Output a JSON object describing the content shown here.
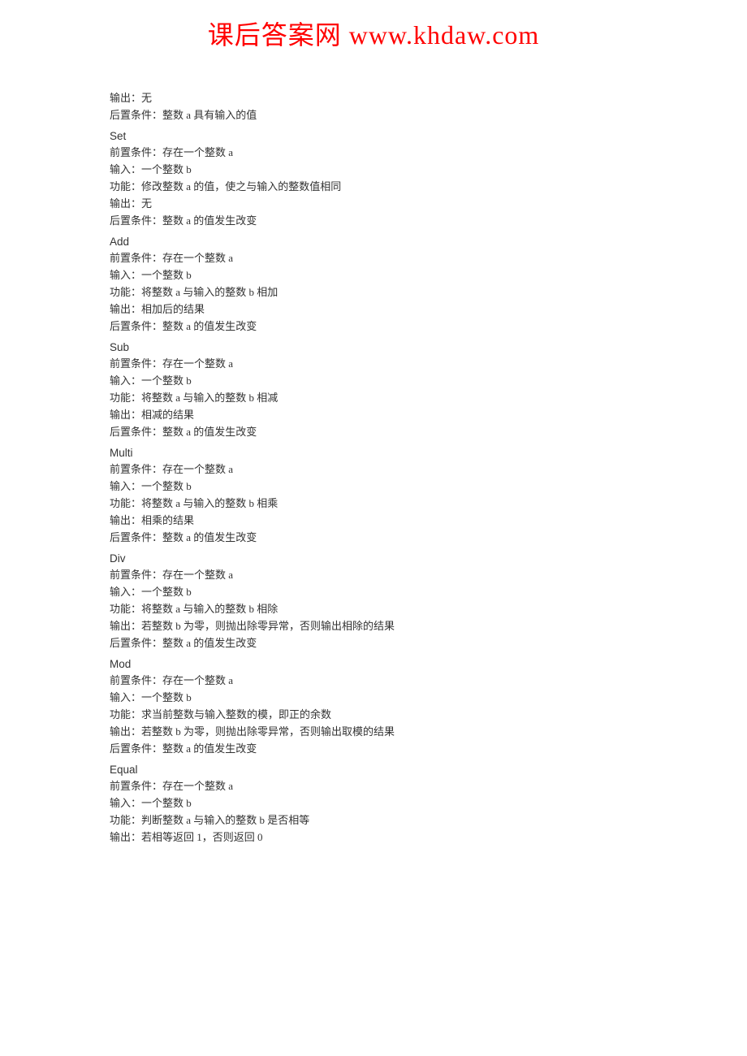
{
  "watermark": "课后答案网 www.khdaw.com",
  "intro": {
    "output": "输出：无",
    "post": "后置条件：整数 a 具有输入的值"
  },
  "sections": [
    {
      "title": "Set",
      "lines": [
        "前置条件：存在一个整数 a",
        "输入：一个整数 b",
        "功能：修改整数 a 的值，使之与输入的整数值相同",
        "输出：无",
        "后置条件：整数 a 的值发生改变"
      ]
    },
    {
      "title": "Add",
      "lines": [
        "前置条件：存在一个整数 a",
        "输入：一个整数 b",
        "功能：将整数 a 与输入的整数 b 相加",
        "输出：相加后的结果",
        "后置条件：整数 a 的值发生改变"
      ]
    },
    {
      "title": "Sub",
      "lines": [
        "前置条件：存在一个整数 a",
        "输入：一个整数 b",
        "功能：将整数 a 与输入的整数 b 相减",
        "输出：相减的结果",
        "后置条件：整数 a 的值发生改变"
      ]
    },
    {
      "title": "Multi",
      "lines": [
        "前置条件：存在一个整数 a",
        "输入：一个整数 b",
        "功能：将整数 a 与输入的整数 b 相乘",
        "输出：相乘的结果",
        "后置条件：整数 a 的值发生改变"
      ]
    },
    {
      "title": "Div",
      "lines": [
        "前置条件：存在一个整数 a",
        "输入：一个整数 b",
        "功能：将整数 a 与输入的整数 b 相除",
        "输出：若整数 b 为零，则抛出除零异常，否则输出相除的结果",
        "后置条件：整数 a 的值发生改变"
      ]
    },
    {
      "title": "Mod",
      "lines": [
        "前置条件：存在一个整数 a",
        "输入：一个整数 b",
        "功能：求当前整数与输入整数的模，即正的余数",
        "输出：若整数 b 为零，则抛出除零异常，否则输出取模的结果",
        "后置条件：整数 a 的值发生改变"
      ]
    },
    {
      "title": "Equal",
      "lines": [
        "前置条件：存在一个整数 a",
        "输入：一个整数 b",
        "功能：判断整数 a 与输入的整数 b 是否相等",
        "输出：若相等返回 1，否则返回 0"
      ]
    }
  ]
}
